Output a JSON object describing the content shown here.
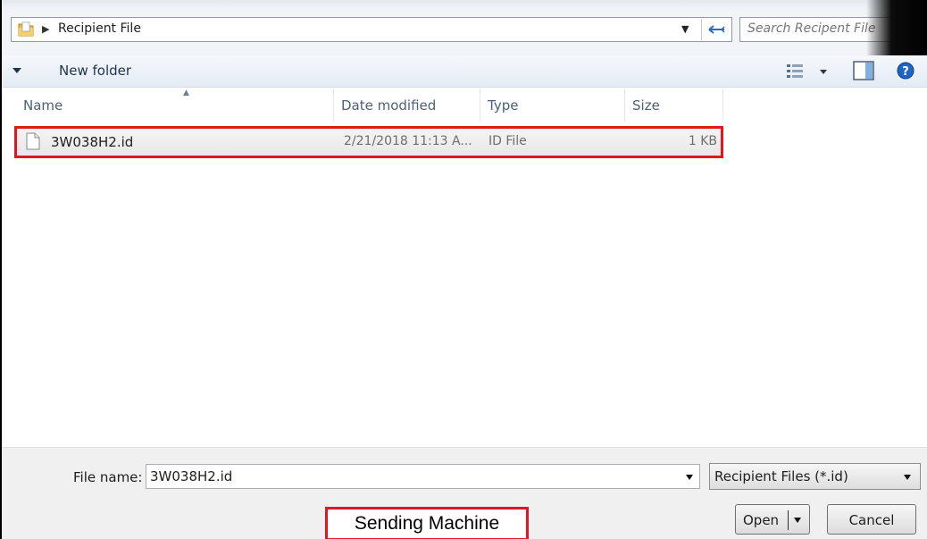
{
  "address_bar": {
    "breadcrumb": "Recipient File",
    "search_placeholder": "Search Recipent File"
  },
  "toolbar": {
    "new_folder_label": "New folder"
  },
  "columns": {
    "name": "Name",
    "date_modified": "Date modified",
    "type": "Type",
    "size": "Size"
  },
  "files": [
    {
      "name": "3W038H2.id",
      "date_modified": "2/21/2018 11:13 A...",
      "type": "ID File",
      "size": "1 KB"
    }
  ],
  "bottom": {
    "file_name_label": "File name:",
    "file_name_value": "3W038H2.id",
    "filter_selected": "Recipient Files (*.id)",
    "open_label": "Open",
    "cancel_label": "Cancel"
  },
  "annotation": {
    "label": "Sending Machine"
  },
  "colors": {
    "highlight_border": "#e3161d",
    "header_text": "#4c607a",
    "toolbar_text": "#1e3350"
  }
}
